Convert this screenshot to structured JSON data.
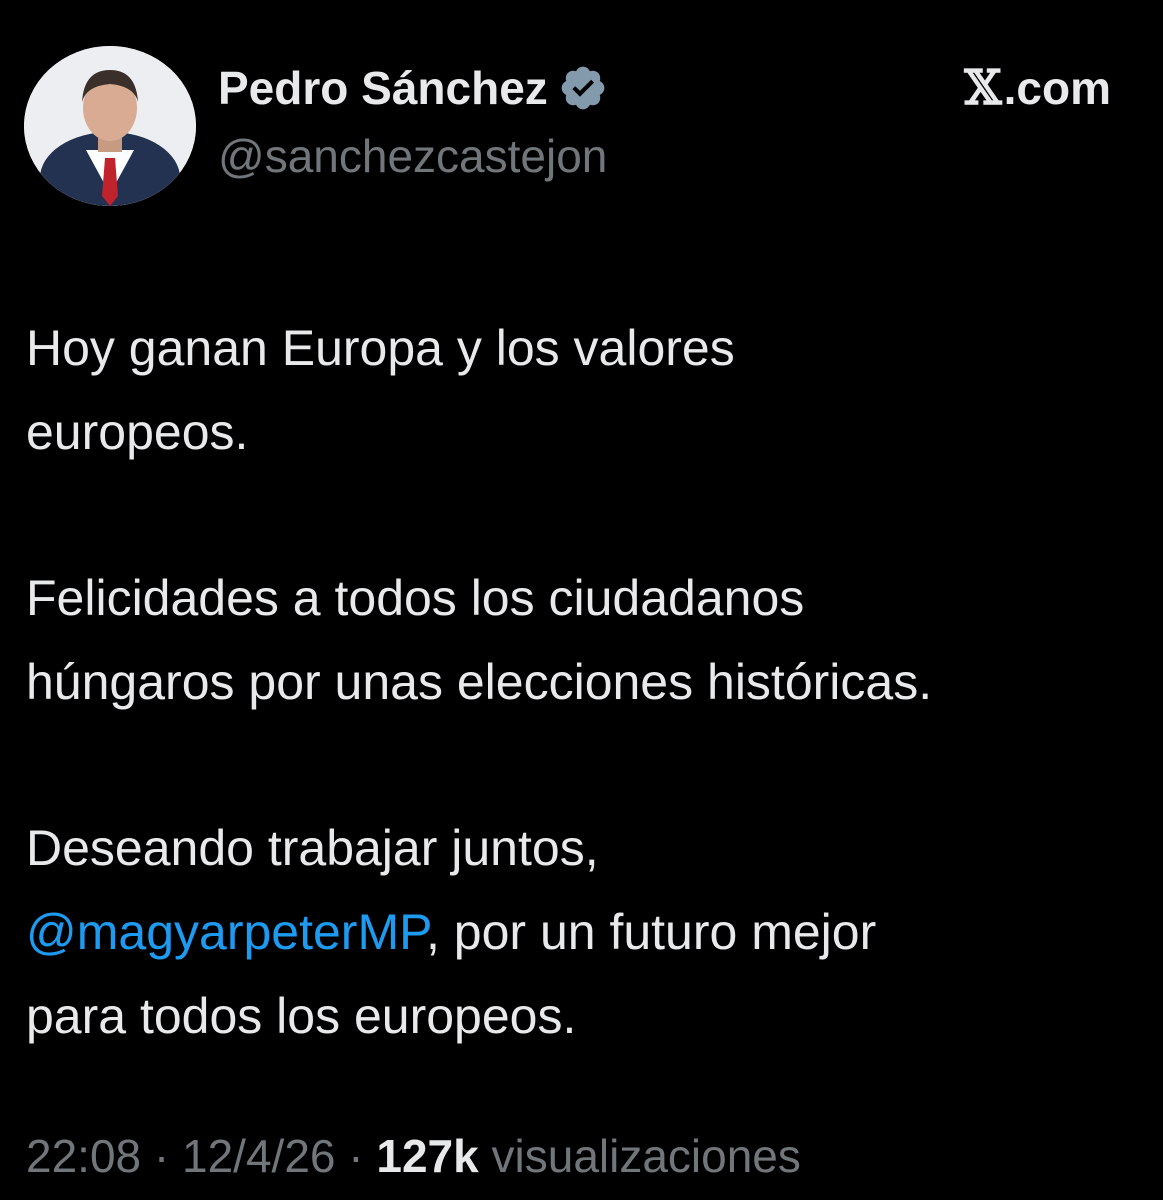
{
  "tweet": {
    "author": {
      "name": "Pedro Sánchez",
      "handle": "@sanchezcastejon"
    },
    "brand": {
      "x_glyph": "𝕏",
      "domain": ".com"
    },
    "paragraphs": [
      {
        "lines": [
          "Hoy ganan Europa y los valores",
          "europeos."
        ]
      },
      {
        "lines": [
          "Felicidades a todos los ciudadanos",
          "húngaros por unas elecciones históricas."
        ]
      },
      {
        "line1": "Deseando trabajar juntos,",
        "mention": "@magyarpeterMP",
        "line2_rest": ", por un futuro mejor",
        "line3": "para todos los europeos."
      }
    ],
    "meta": {
      "time": "22:08",
      "separator1": " · ",
      "date": "12/4/26",
      "separator2": " · ",
      "views_count": "127k",
      "views_label": " visualizaciones"
    },
    "colors": {
      "background": "#000000",
      "text": "#e7e9ea",
      "secondary": "#71767b",
      "link": "#1d9bf0"
    }
  }
}
